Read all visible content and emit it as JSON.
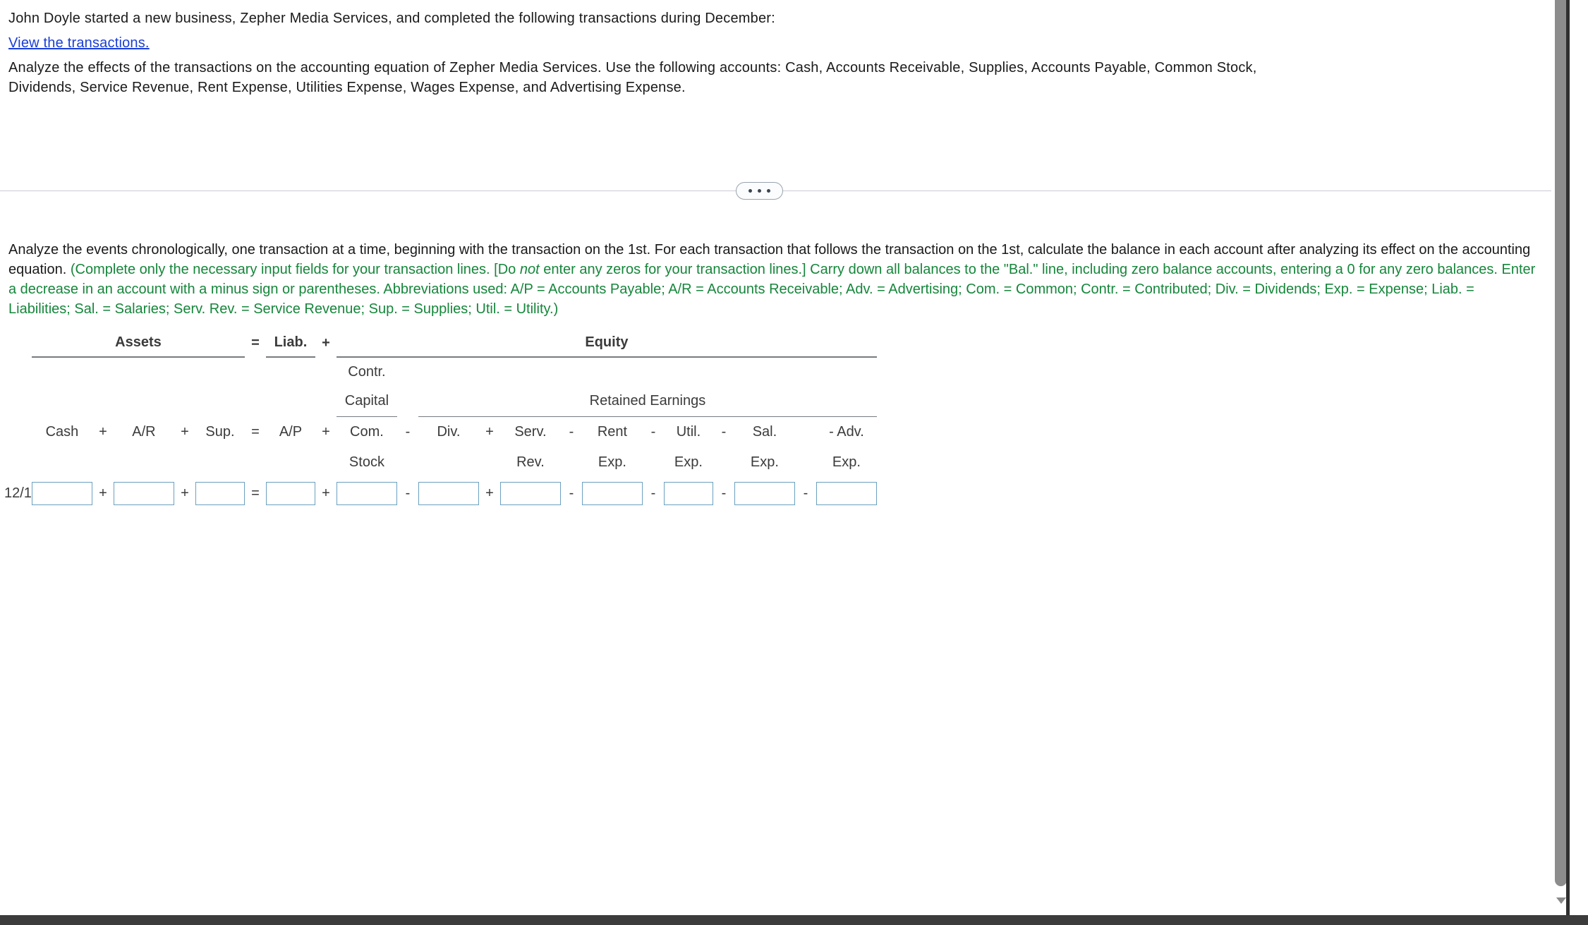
{
  "intro": {
    "line1": "John Doyle started a new business, Zepher Media Services, and completed the following transactions during December:",
    "link": "View the transactions.",
    "line2": "Analyze the effects of the transactions on the accounting equation of Zepher Media Services. Use the following accounts: Cash, Accounts Receivable, Supplies, Accounts Payable, Common Stock, Dividends, Service Revenue, Rent Expense, Utilities Expense, Wages Expense, and Advertising Expense."
  },
  "divider": {
    "dots_label": "..."
  },
  "instructions": {
    "black_part": "Analyze the events chronologically, one transaction at a time, beginning with the transaction on the 1st. For each transaction that follows the transaction on the 1st, calculate the balance in each account after analyzing its effect on the accounting equation. ",
    "green_part_a": "(Complete only the necessary input fields for your transaction lines. [Do ",
    "green_italic": "not",
    "green_part_b": " enter any zeros for your transaction lines.] Carry down all balances to the \"Bal.\" line, including zero balance accounts, entering a 0 for any zero balances. Enter a decrease in an account with a minus sign or parentheses. Abbreviations used: A/P = Accounts Payable; A/R = Accounts Receivable; Adv. = Advertising; Com. = Common; Contr. = Contributed; Div. = Dividends; Exp. = Expense; Liab. = Liabilities; Sal. = Salaries; Serv. Rev. = Service Revenue; Sup. = Supplies; Util. = Utility.)"
  },
  "table": {
    "groups": {
      "assets": "Assets",
      "eq_sign": "=",
      "liab": "Liab.",
      "plus_sign": "+",
      "equity": "Equity"
    },
    "subgroups": {
      "contr": "Contr.",
      "capital": "Capital",
      "retained_earnings": "Retained Earnings"
    },
    "columns": [
      {
        "label_top": "Cash",
        "label_bottom": "",
        "op_before": ""
      },
      {
        "label_top": "A/R",
        "label_bottom": "",
        "op_before": "+"
      },
      {
        "label_top": "Sup.",
        "label_bottom": "",
        "op_before": "+"
      },
      {
        "label_top": "A/P",
        "label_bottom": "",
        "op_before": "="
      },
      {
        "label_top": "Com.",
        "label_bottom": "Stock",
        "op_before": "+"
      },
      {
        "label_top": "Div.",
        "label_bottom": "",
        "op_before": "-"
      },
      {
        "label_top": "Serv.",
        "label_bottom": "Rev.",
        "op_before": "+"
      },
      {
        "label_top": "Rent",
        "label_bottom": "Exp.",
        "op_before": "-"
      },
      {
        "label_top": "Util.",
        "label_bottom": "Exp.",
        "op_before": "-"
      },
      {
        "label_top": "Sal.",
        "label_bottom": "Exp.",
        "op_before": "-"
      },
      {
        "label_top": "- Adv.",
        "label_bottom": "Exp.",
        "op_before": "-"
      }
    ],
    "rows": [
      {
        "date": "12/1",
        "values": [
          "",
          "",
          "",
          "",
          "",
          "",
          "",
          "",
          "",
          "",
          ""
        ]
      }
    ]
  },
  "colors": {
    "link": "#1a3ed6",
    "green_instruction": "#16863b",
    "input_border": "#6ba0c0",
    "rule_line": "#777b80",
    "scrollbar_thumb": "#8c8c8c"
  }
}
